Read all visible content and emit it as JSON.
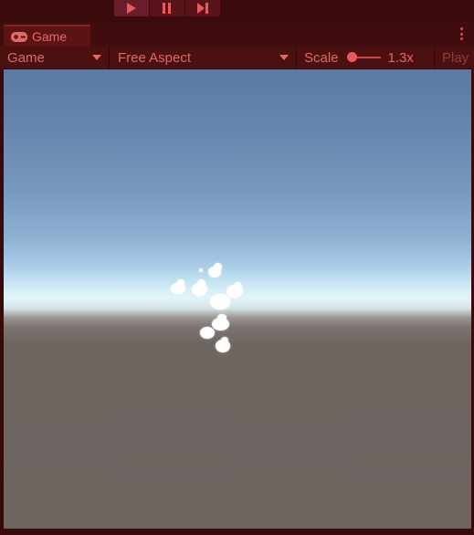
{
  "play_controls": {
    "play_icon": "play-icon",
    "pause_icon": "pause-icon",
    "step_icon": "step-icon"
  },
  "window": {
    "tab_label": "Game",
    "tab_icon": "gamepad-icon",
    "menu_icon": "kebab-menu-icon"
  },
  "toolbar": {
    "display_value": "Game",
    "aspect_value": "Free Aspect",
    "scale_label": "Scale",
    "scale_value": "1.3x",
    "scale_level_fraction": 0.0,
    "play_mode_label": "Play"
  },
  "colors": {
    "accent": "#e26767",
    "playmode_tint": "#4b1010"
  },
  "scene": {
    "description_icon": "particle-cloud-icon"
  }
}
